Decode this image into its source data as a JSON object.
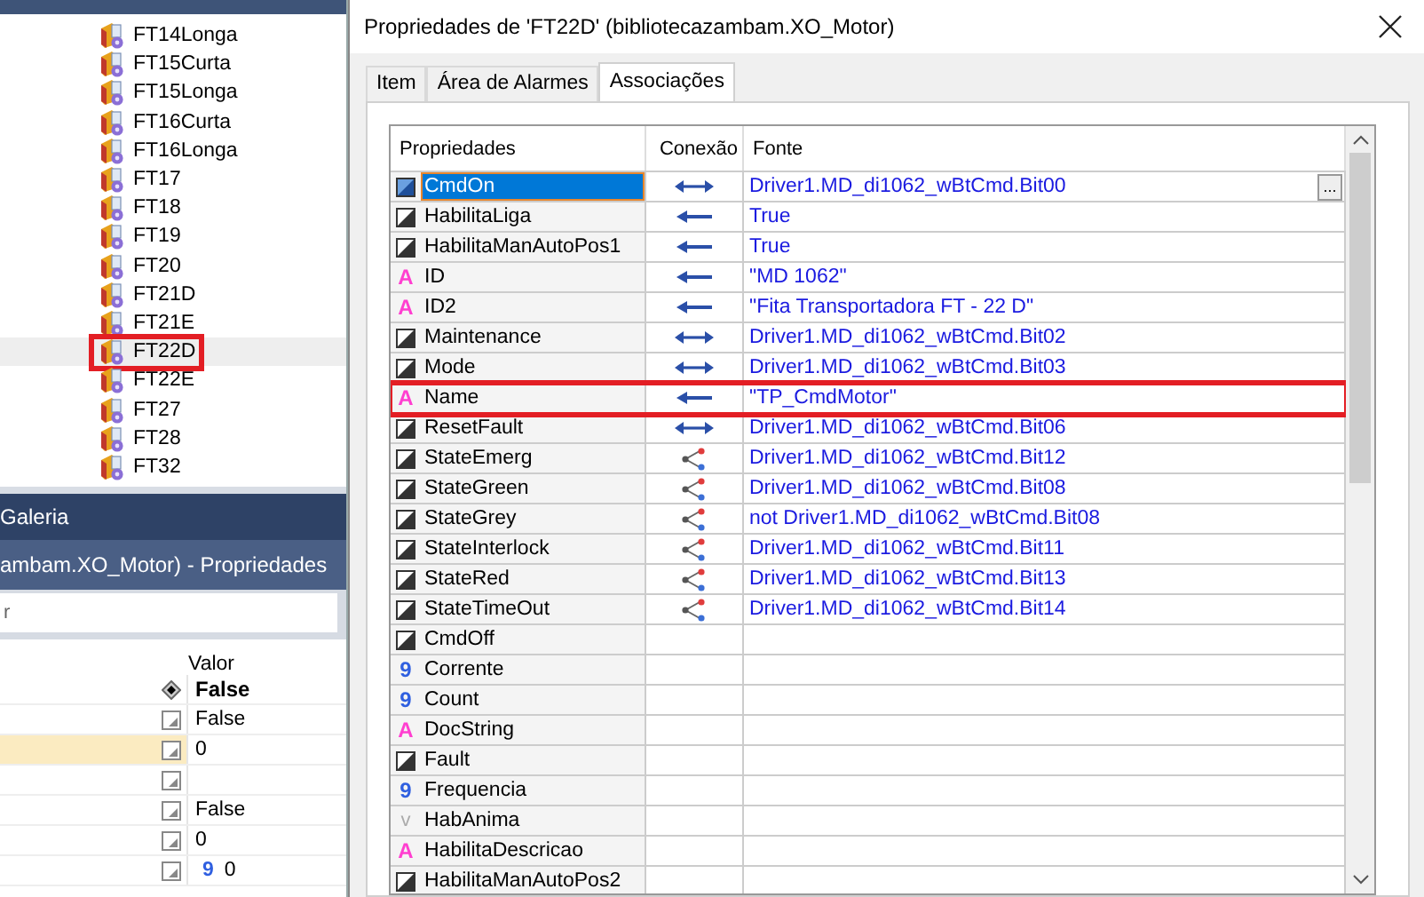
{
  "tree": {
    "items": [
      {
        "label": "FT14Longa",
        "selected": false,
        "highlighted": false
      },
      {
        "label": "FT15Curta",
        "selected": false,
        "highlighted": false
      },
      {
        "label": "FT15Longa",
        "selected": false,
        "highlighted": false
      },
      {
        "label": "FT16Curta",
        "selected": false,
        "highlighted": false
      },
      {
        "label": "FT16Longa",
        "selected": false,
        "highlighted": false
      },
      {
        "label": "FT17",
        "selected": false,
        "highlighted": false
      },
      {
        "label": "FT18",
        "selected": false,
        "highlighted": false
      },
      {
        "label": "FT19",
        "selected": false,
        "highlighted": false
      },
      {
        "label": "FT20",
        "selected": false,
        "highlighted": false
      },
      {
        "label": "FT21D",
        "selected": false,
        "highlighted": false
      },
      {
        "label": "FT21E",
        "selected": false,
        "highlighted": false
      },
      {
        "label": "FT22D",
        "selected": true,
        "highlighted": true
      },
      {
        "label": "FT22E",
        "selected": false,
        "highlighted": false
      },
      {
        "label": "FT27",
        "selected": false,
        "highlighted": false
      },
      {
        "label": "FT28",
        "selected": false,
        "highlighted": false
      },
      {
        "label": "FT32",
        "selected": false,
        "highlighted": false
      }
    ]
  },
  "gallery_bar": {
    "title": "Galeria"
  },
  "properties_panel": {
    "title": "ambam.XO_Motor) - Propriedades",
    "search": {
      "placeholder": "r"
    },
    "value_header": "Valor",
    "rows": [
      {
        "kind": "default",
        "value": "False",
        "selected": false
      },
      {
        "kind": "edit",
        "value": "False",
        "selected": false
      },
      {
        "kind": "edit",
        "value": "0",
        "selected": true
      },
      {
        "kind": "edit",
        "value": "",
        "selected": false
      },
      {
        "kind": "edit",
        "value": "False",
        "selected": false
      },
      {
        "kind": "edit",
        "value": "0",
        "selected": false
      },
      {
        "kind": "edit",
        "icon": "9",
        "value": "0",
        "selected": false
      }
    ]
  },
  "dialog": {
    "title": "Propriedades de 'FT22D' (bibliotecazambam.XO_Motor)",
    "tabs": [
      {
        "label": "Item",
        "selected": false
      },
      {
        "label": "Área de Alarmes",
        "selected": false
      },
      {
        "label": "Associações",
        "selected": true
      }
    ],
    "columns": [
      "Propriedades",
      "Conexão",
      "Fonte"
    ],
    "rows": [
      {
        "kind": "bool",
        "name": "CmdOn",
        "connection": {
          "kind": "bidirectional"
        },
        "source": "Driver1.MD_di1062_wBtCmd.Bit00",
        "browse_button": "...",
        "selected": true,
        "highlighted": false
      },
      {
        "kind": "bool",
        "name": "HabilitaLiga",
        "connection": {
          "kind": "left"
        },
        "source": "True",
        "selected": false,
        "highlighted": false
      },
      {
        "kind": "bool",
        "name": "HabilitaManAutoPos1",
        "connection": {
          "kind": "left"
        },
        "source": "True",
        "selected": false,
        "highlighted": false
      },
      {
        "kind": "text",
        "type_icon": "A",
        "name": "ID",
        "connection": {
          "kind": "left"
        },
        "source": "\"MD 1062\"",
        "selected": false,
        "highlighted": false
      },
      {
        "kind": "text",
        "type_icon": "A",
        "name": "ID2",
        "connection": {
          "kind": "left"
        },
        "source": "\"Fita Transportadora FT - 22 D\"",
        "selected": false,
        "highlighted": false
      },
      {
        "kind": "bool",
        "name": "Maintenance",
        "connection": {
          "kind": "bidirectional"
        },
        "source": "Driver1.MD_di1062_wBtCmd.Bit02",
        "selected": false,
        "highlighted": false
      },
      {
        "kind": "bool",
        "name": "Mode",
        "connection": {
          "kind": "bidirectional"
        },
        "source": "Driver1.MD_di1062_wBtCmd.Bit03",
        "selected": false,
        "highlighted": false
      },
      {
        "kind": "text",
        "type_icon": "A",
        "name": "Name",
        "connection": {
          "kind": "left"
        },
        "source": "\"TP_CmdMotor\"",
        "selected": false,
        "highlighted": true
      },
      {
        "kind": "bool",
        "name": "ResetFault",
        "connection": {
          "kind": "bidirectional"
        },
        "source": "Driver1.MD_di1062_wBtCmd.Bit06",
        "selected": false,
        "highlighted": false
      },
      {
        "kind": "bool",
        "name": "StateEmerg",
        "connection": {
          "kind": "multiple"
        },
        "source": "Driver1.MD_di1062_wBtCmd.Bit12",
        "selected": false,
        "highlighted": false
      },
      {
        "kind": "bool",
        "name": "StateGreen",
        "connection": {
          "kind": "multiple"
        },
        "source": "Driver1.MD_di1062_wBtCmd.Bit08",
        "selected": false,
        "highlighted": false
      },
      {
        "kind": "bool",
        "name": "StateGrey",
        "connection": {
          "kind": "multiple"
        },
        "source": "not Driver1.MD_di1062_wBtCmd.Bit08",
        "selected": false,
        "highlighted": false
      },
      {
        "kind": "bool",
        "name": "StateInterlock",
        "connection": {
          "kind": "multiple"
        },
        "source": "Driver1.MD_di1062_wBtCmd.Bit11",
        "selected": false,
        "highlighted": false
      },
      {
        "kind": "bool",
        "name": "StateRed",
        "connection": {
          "kind": "multiple"
        },
        "source": "Driver1.MD_di1062_wBtCmd.Bit13",
        "selected": false,
        "highlighted": false
      },
      {
        "kind": "bool",
        "name": "StateTimeOut",
        "connection": {
          "kind": "multiple"
        },
        "source": "Driver1.MD_di1062_wBtCmd.Bit14",
        "selected": false,
        "highlighted": false
      },
      {
        "kind": "bool",
        "name": "CmdOff",
        "selected": false,
        "highlighted": false
      },
      {
        "kind": "number",
        "type_icon": "9",
        "name": "Corrente",
        "selected": false,
        "highlighted": false
      },
      {
        "kind": "number",
        "type_icon": "9",
        "name": "Count",
        "selected": false,
        "highlighted": false
      },
      {
        "kind": "text",
        "type_icon": "A",
        "name": "DocString",
        "selected": false,
        "highlighted": false
      },
      {
        "kind": "bool",
        "name": "Fault",
        "selected": false,
        "highlighted": false
      },
      {
        "kind": "number",
        "type_icon": "9",
        "name": "Frequencia",
        "selected": false,
        "highlighted": false
      },
      {
        "kind": "variant",
        "type_icon": "v",
        "name": "HabAnima",
        "selected": false,
        "highlighted": false
      },
      {
        "kind": "text",
        "type_icon": "A",
        "name": "HabilitaDescricao",
        "selected": false,
        "highlighted": false
      },
      {
        "kind": "bool",
        "name": "HabilitaManAutoPos2",
        "selected": false,
        "highlighted": false
      }
    ]
  }
}
